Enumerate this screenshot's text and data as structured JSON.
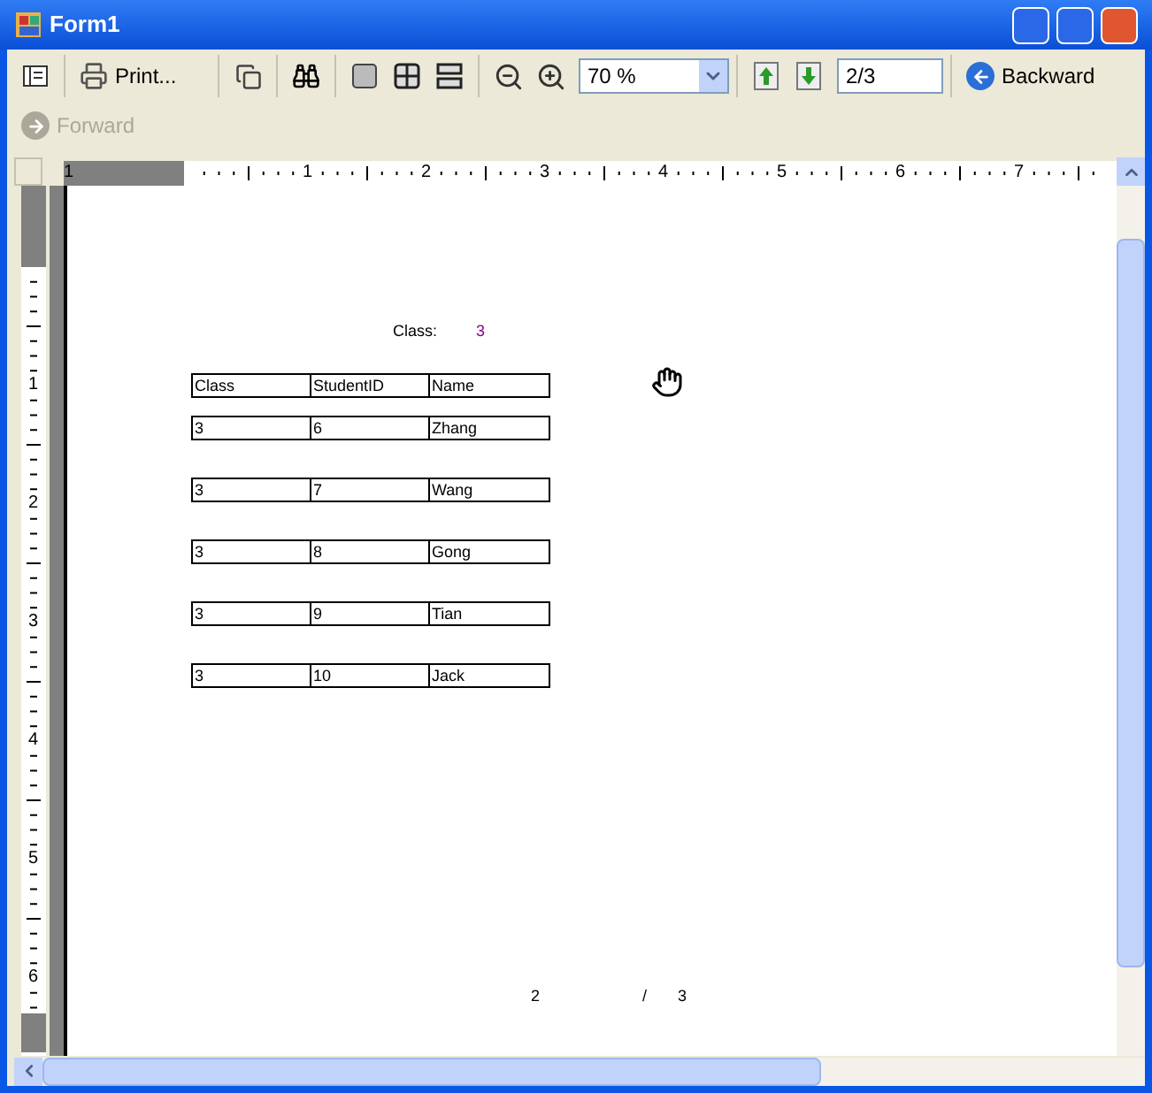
{
  "window": {
    "title": "Form1"
  },
  "toolbar": {
    "print_label": "Print...",
    "zoom": "70 %",
    "page": "2/3",
    "nav": [
      {
        "label": "Backward",
        "disabled": false
      },
      {
        "label": "Forward",
        "disabled": true
      }
    ]
  },
  "ruler": {
    "horizontal": [
      "1",
      "1",
      "2",
      "3",
      "4",
      "5",
      "6",
      "7"
    ],
    "vertical": [
      "1",
      "2",
      "3",
      "4",
      "5",
      "6"
    ]
  },
  "report": {
    "class_label": "Class:",
    "class_value": "3",
    "columns": [
      "Class",
      "StudentID",
      "Name"
    ],
    "rows": [
      [
        "3",
        "6",
        "Zhang"
      ],
      [
        "3",
        "7",
        "Wang"
      ],
      [
        "3",
        "8",
        "Gong"
      ],
      [
        "3",
        "9",
        "Tian"
      ],
      [
        "3",
        "10",
        "Jack"
      ]
    ],
    "footer": [
      "2",
      "/",
      "3"
    ]
  }
}
